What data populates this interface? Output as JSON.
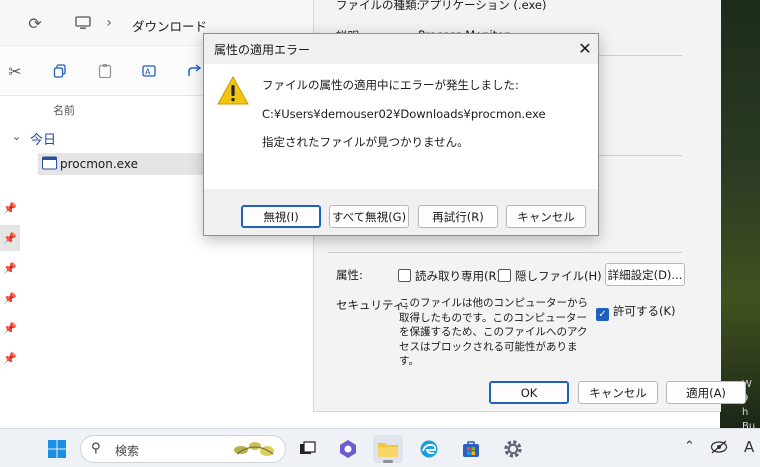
{
  "explorer": {
    "breadcrumb": "ダウンロード",
    "column_name": "名前",
    "group_today": "今日",
    "file": "procmon.exe"
  },
  "properties": {
    "file_type_label": "ファイルの種類:",
    "file_type_value": "アプリケーション (.exe)",
    "description_label": "説明:",
    "description_value": "Process Monitor",
    "attributes_label": "属性:",
    "readonly_label": "読み取り専用(R)",
    "hidden_label": "隠しファイル(H)",
    "advanced_button": "詳細設定(D)...",
    "security_label": "セキュリティ:",
    "security_text": "このファイルは他のコンピューターから取得したものです。このコンピューターを保護するため、このファイルへのアクセスはブロックされる可能性があります。",
    "unblock_label": "許可する(K)",
    "unblock_checked": true,
    "ok_button": "OK",
    "cancel_button": "キャンセル",
    "apply_button": "適用(A)"
  },
  "dialog": {
    "title": "属性の適用エラー",
    "message": "ファイルの属性の適用中にエラーが発生しました:",
    "path": "C:¥Users¥demouser02¥Downloads¥procmon.exe",
    "detail": "指定されたファイルが見つかりません。",
    "buttons": {
      "ignore": "無視(I)",
      "ignore_all": "すべて無視(G)",
      "retry": "再試行(R)",
      "cancel": "キャンセル"
    }
  },
  "taskbar": {
    "search_placeholder": "検索",
    "tray_letter": "A"
  },
  "desktop": {
    "wallpaper_text_lines": [
      "W",
      "9",
      "h",
      "Bu"
    ]
  },
  "colors": {
    "accent": "#1f5fbf",
    "warning_yellow": "#f2c40f"
  }
}
